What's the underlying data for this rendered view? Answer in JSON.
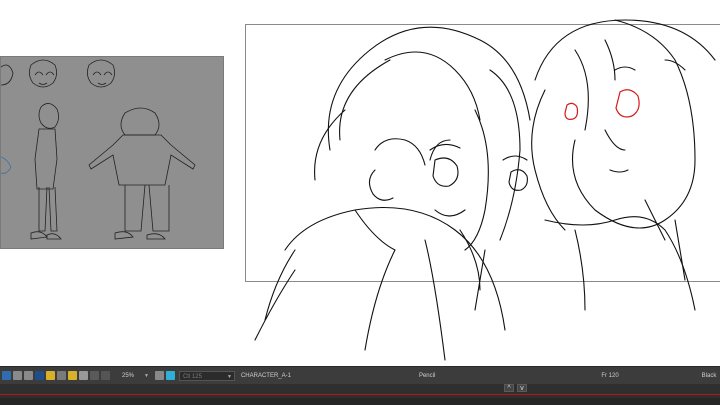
{
  "statusbar": {
    "zoom": "25%",
    "frame_placeholder": "Ctl 125",
    "element": "CHARACTER_A-1",
    "tool": "Pencil",
    "frame": "Fr 120",
    "color": "Black"
  },
  "timeline": {
    "up_label": "^",
    "down_label": "v"
  },
  "icons": {
    "colors": [
      "#2f6db0",
      "#8a8a8a",
      "#8a8a8a",
      "#1e4f8a",
      "#d9b02a",
      "#7a7a7a",
      "#d9b02a",
      "#999",
      "#5a5a5a",
      "#555",
      "#2fb0d6"
    ]
  }
}
